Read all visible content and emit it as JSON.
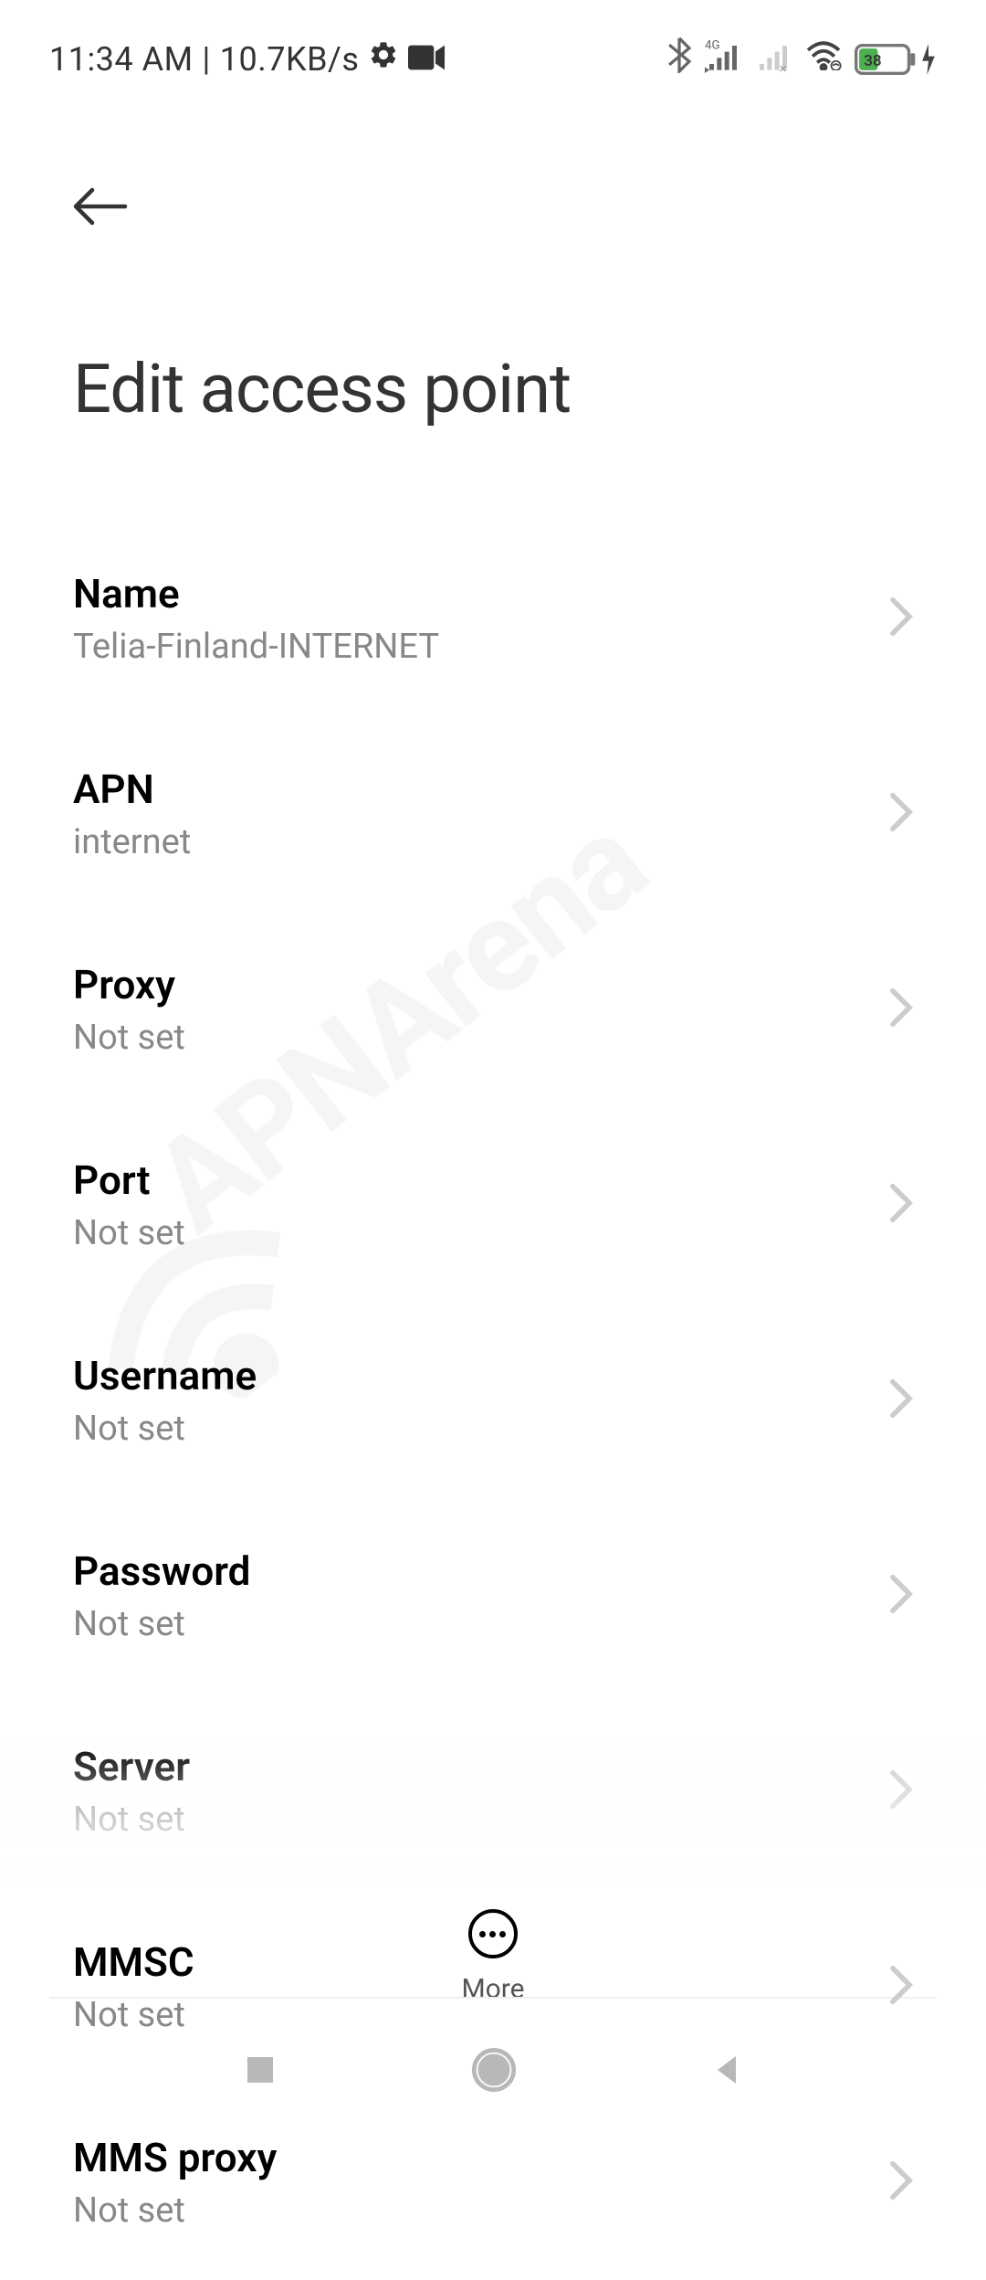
{
  "statusBar": {
    "time": "11:34 AM",
    "separator": "|",
    "dataRate": "10.7KB/s",
    "battery": "38"
  },
  "header": {
    "title": "Edit access point"
  },
  "settings": [
    {
      "label": "Name",
      "value": "Telia-Finland-INTERNET"
    },
    {
      "label": "APN",
      "value": "internet"
    },
    {
      "label": "Proxy",
      "value": "Not set"
    },
    {
      "label": "Port",
      "value": "Not set"
    },
    {
      "label": "Username",
      "value": "Not set"
    },
    {
      "label": "Password",
      "value": "Not set"
    },
    {
      "label": "Server",
      "value": "Not set"
    },
    {
      "label": "MMSC",
      "value": "Not set"
    },
    {
      "label": "MMS proxy",
      "value": "Not set"
    }
  ],
  "bottomBar": {
    "moreLabel": "More"
  },
  "watermark": "APNArena"
}
